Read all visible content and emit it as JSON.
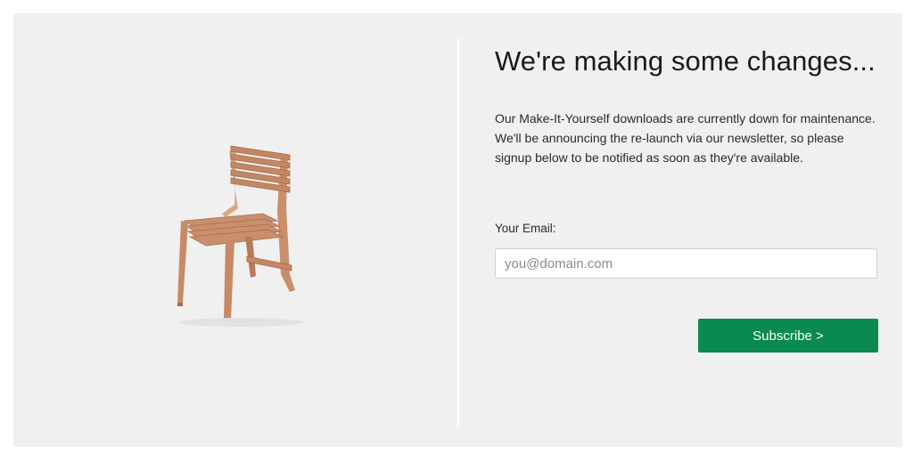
{
  "hero": {
    "image_alt": "wooden-slat-chair",
    "colors": {
      "wood": "#c98f6c",
      "wood_dark": "#a86d4d",
      "wood_edge": "#e9c9b0"
    }
  },
  "content": {
    "title": "We're making some changes...",
    "description_lines": [
      "Our Make-It-Yourself downloads are currently down for maintenance.",
      "We'll be announcing the re-launch via our newsletter, so please",
      "signup below to be notified as soon as they're available."
    ]
  },
  "form": {
    "email_label": "Your Email:",
    "email_placeholder": "you@domain.com",
    "email_value": "",
    "subscribe_label": "Subscribe >"
  },
  "colors": {
    "panel_bg": "#f0f0f0",
    "button_bg": "#0a8a4e",
    "button_text": "#ffffff"
  }
}
